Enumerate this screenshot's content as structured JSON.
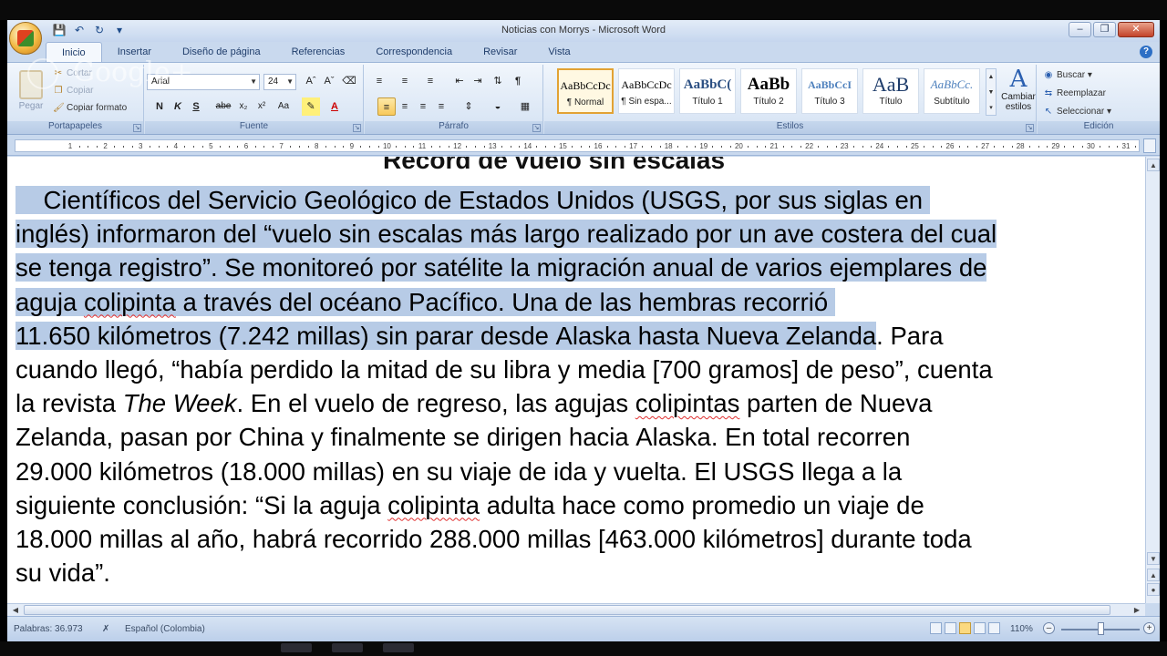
{
  "window": {
    "title": "Noticias con Morrys - Microsoft Word"
  },
  "overlay": {
    "google_text": "Google+"
  },
  "tabs": [
    {
      "label": "Inicio"
    },
    {
      "label": "Insertar"
    },
    {
      "label": "Diseño de página"
    },
    {
      "label": "Referencias"
    },
    {
      "label": "Correspondencia"
    },
    {
      "label": "Revisar"
    },
    {
      "label": "Vista"
    }
  ],
  "ribbon": {
    "clipboard": {
      "label": "Portapapeles",
      "paste": "Pegar",
      "cut": "Cortar",
      "copy": "Copiar",
      "format_painter": "Copiar formato"
    },
    "font": {
      "label": "Fuente",
      "font_name": "Arial",
      "font_size": "24"
    },
    "paragraph": {
      "label": "Párrafo"
    },
    "styles": {
      "label": "Estilos",
      "items": [
        {
          "sample": "AaBbCcDc",
          "name": "¶ Normal"
        },
        {
          "sample": "AaBbCcDc",
          "name": "¶ Sin espa..."
        },
        {
          "sample": "AaBbC(",
          "name": "Título 1"
        },
        {
          "sample": "AaBb",
          "name": "Título 2"
        },
        {
          "sample": "AaBbCcI",
          "name": "Título 3"
        },
        {
          "sample": "AaB",
          "name": "Título"
        },
        {
          "sample": "AaBbCc.",
          "name": "Subtítulo"
        }
      ],
      "change_styles": "Cambiar estilos"
    },
    "editing": {
      "label": "Edición",
      "find": "Buscar",
      "replace": "Reemplazar",
      "select": "Seleccionar"
    }
  },
  "ruler": {
    "numbers": [
      "1",
      "2",
      "3",
      "4",
      "5",
      "6",
      "7",
      "8",
      "9",
      "10",
      "11",
      "12",
      "13",
      "14",
      "15",
      "16",
      "17",
      "18",
      "19",
      "20",
      "21",
      "22",
      "23",
      "24",
      "25",
      "26",
      "27",
      "28",
      "29",
      "30",
      "31"
    ]
  },
  "document": {
    "heading_partial": "Record de vuelo sin escalas",
    "lines": [
      {
        "segments": [
          {
            "text": "    Científicos del Servicio Geológico de Estados Unidos (USGS, por sus siglas en ",
            "sel": true
          }
        ]
      },
      {
        "segments": [
          {
            "text": "inglés) informaron del “vuelo sin escalas más largo realizado por un ave costera del cual",
            "sel": true
          }
        ]
      },
      {
        "segments": [
          {
            "text": "se tenga registro”. Se monitoreó por satélite la migración anual de varios ejemplares de",
            "sel": true
          }
        ]
      },
      {
        "segments": [
          {
            "text": "aguja ",
            "sel": true
          },
          {
            "text": "colipinta",
            "sel": true,
            "spell": true
          },
          {
            "text": " a través del océano Pacífico. Una de las hembras recorrió ",
            "sel": true
          }
        ]
      },
      {
        "segments": [
          {
            "text": "11.650 kilómetros (7.242 millas) sin parar desde Alaska hasta Nueva Zelanda",
            "sel": true
          },
          {
            "text": ". Para"
          }
        ]
      },
      {
        "segments": [
          {
            "text": "cuando llegó, “había perdido la mitad de su libra y media [700 gramos] de peso”, cuenta"
          }
        ]
      },
      {
        "segments": [
          {
            "text": "la revista "
          },
          {
            "text": "The Week",
            "ital": true
          },
          {
            "text": ". En el vuelo de regreso, las agujas "
          },
          {
            "text": "colipintas",
            "spell": true
          },
          {
            "text": " parten de Nueva"
          }
        ]
      },
      {
        "segments": [
          {
            "text": "Zelanda, pasan por China y finalmente se dirigen hacia Alaska. En total recorren"
          }
        ]
      },
      {
        "segments": [
          {
            "text": "29.000 kilómetros (18.000 millas) en su viaje de ida y vuelta. El USGS llega a la"
          }
        ]
      },
      {
        "segments": [
          {
            "text": "siguiente conclusión: “Si la aguja "
          },
          {
            "text": "colipinta",
            "spell": true
          },
          {
            "text": " adulta hace como promedio un viaje de"
          }
        ]
      },
      {
        "segments": [
          {
            "text": "18.000 millas al año, habrá recorrido 288.000 millas [463.000 kilómetros] durante toda"
          }
        ]
      },
      {
        "segments": [
          {
            "text": "su vida”."
          }
        ]
      }
    ]
  },
  "status": {
    "words": "Palabras: 36.973",
    "language": "Español (Colombia)",
    "zoom": "110%"
  },
  "colors": {
    "selection": "#b7cbe6",
    "ribbon_bg": "#dae6f5",
    "accent": "#2d6fc5"
  }
}
